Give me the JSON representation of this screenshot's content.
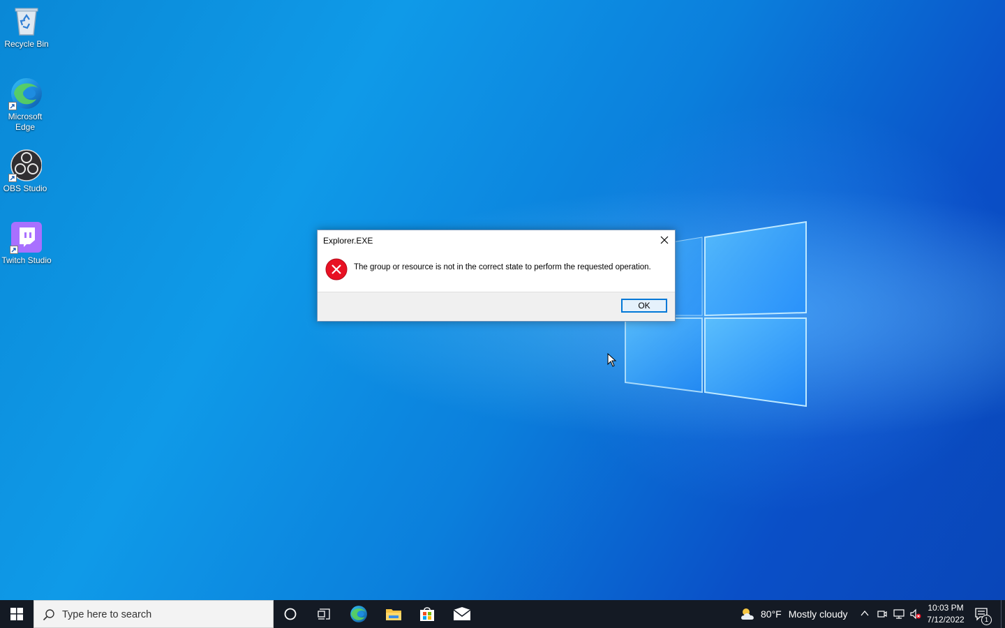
{
  "desktop": {
    "icons": [
      {
        "label": "Recycle Bin",
        "icon": "recycle-bin-icon"
      },
      {
        "label": "Microsoft Edge",
        "icon": "edge-icon"
      },
      {
        "label": "OBS Studio",
        "icon": "obs-icon"
      },
      {
        "label": "Twitch Studio",
        "icon": "twitch-icon"
      }
    ]
  },
  "dialog": {
    "title": "Explorer.EXE",
    "message": "The group or resource is not in the correct state to perform the requested operation.",
    "ok_label": "OK",
    "icon": "error-icon"
  },
  "taskbar": {
    "search_placeholder": "Type here to search",
    "pinned": [
      "cortana-icon",
      "task-view-icon",
      "edge-icon",
      "file-explorer-icon",
      "store-icon",
      "mail-icon"
    ],
    "weather": {
      "temp": "80°F",
      "description": "Mostly cloudy"
    },
    "clock": {
      "time": "10:03 PM",
      "date": "7/12/2022"
    },
    "notification_count": "1"
  },
  "colors": {
    "accent": "#0078d7",
    "error": "#e81123",
    "taskbar": "#141a24"
  }
}
